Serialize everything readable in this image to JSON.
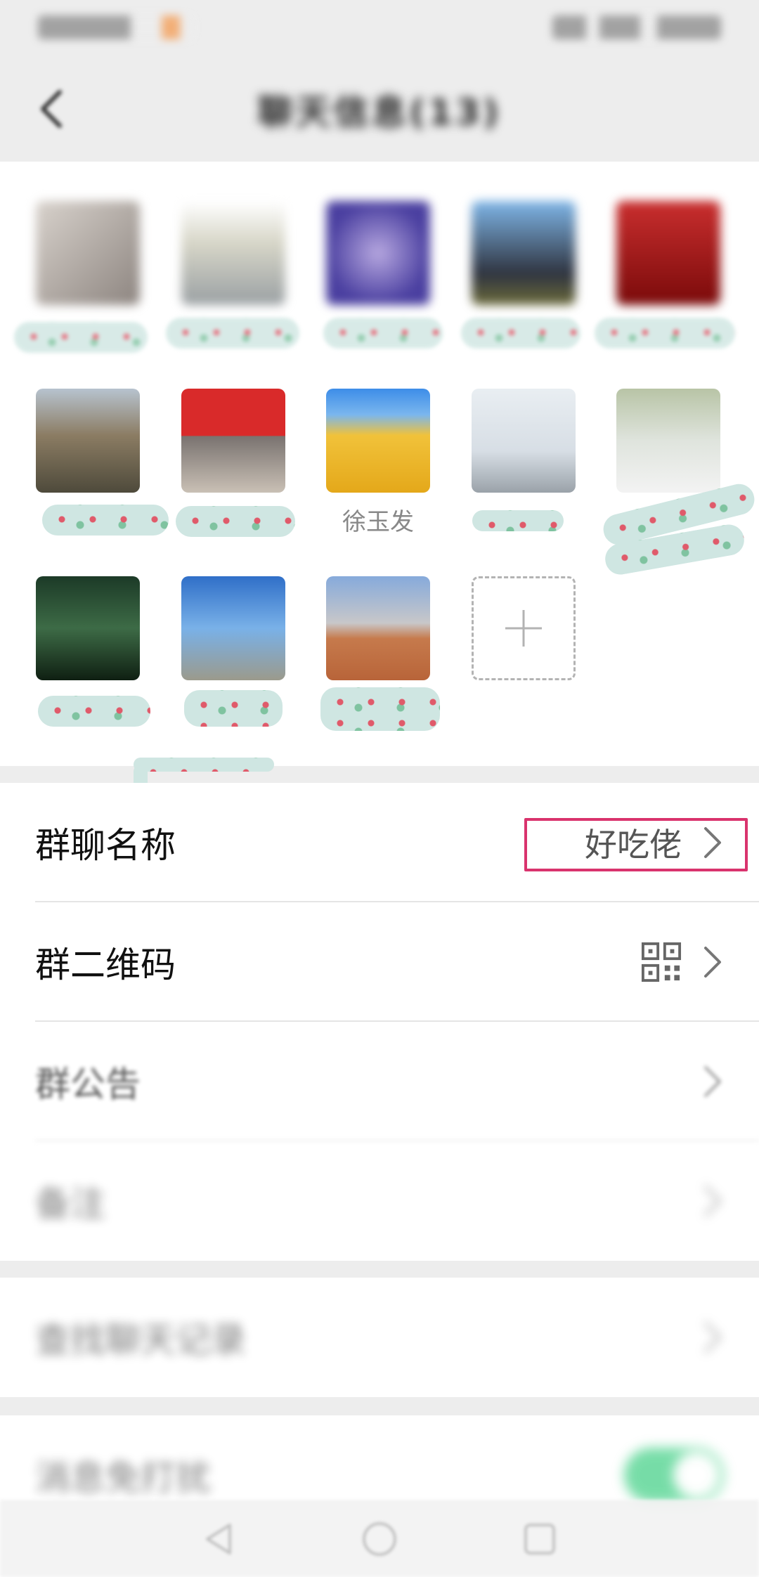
{
  "statusbar": {
    "left_text": "",
    "right_text": ""
  },
  "header": {
    "title": "聊天信息(13)"
  },
  "members": [
    {
      "name": "",
      "bg": "linear-gradient(135deg,#d8d2cc,#8d8580)",
      "blurred": true
    },
    {
      "name": "",
      "bg": "linear-gradient(180deg,#ffffff,#d7d6c8 40%,#9aa0a3)",
      "blurred": true
    },
    {
      "name": "",
      "bg": "radial-gradient(circle,#b7a8e0,#4a3fa0 70%)",
      "blurred": true
    },
    {
      "name": "",
      "bg": "linear-gradient(180deg,#7fb6e8,#2f3440 70%,#6c6b3a)",
      "blurred": true
    },
    {
      "name": "",
      "bg": "linear-gradient(180deg,#c92e2e,#7a0a0a)",
      "blurred": true
    },
    {
      "name": "",
      "bg": "linear-gradient(180deg,#b7c3cf 0%,#8b7c63 45%,#4e4a3b 100%)",
      "blurred": false
    },
    {
      "name": "",
      "bg": "linear-gradient(180deg,#d92a2a 0%,#d92a2a 45%,#7a7370 46%,#c9c0b5 100%)",
      "blurred": false
    },
    {
      "name": "徐玉发",
      "bg": "linear-gradient(180deg,#3d8de8 0%,#7ab6ee 25%,#f1c23a 45%,#e4a81a 100%)",
      "blurred": false
    },
    {
      "name": "",
      "bg": "linear-gradient(180deg,#e9eef2 0%,#d7dee5 60%,#9aa2a9 100%)",
      "blurred": false
    },
    {
      "name": "",
      "bg": "linear-gradient(180deg,#b8c4a6 0%,#dfe4dd 50%,#f3f3f3 100%)",
      "blurred": false
    },
    {
      "name": "",
      "bg": "linear-gradient(180deg,#1c3a27 0%,#3d6b46 50%,#0f1f12 100%)",
      "blurred": false
    },
    {
      "name": "",
      "bg": "linear-gradient(180deg,#2f6fc8 0%,#79b1e8 50%,#9b9a8c 100%)",
      "blurred": false
    },
    {
      "name": "",
      "bg": "linear-gradient(180deg,#86aadb 0%,#c8c7c9 45%,#c67a4c 60%,#b86439 100%)",
      "blurred": false
    }
  ],
  "settings": {
    "group_name": {
      "label": "群聊名称",
      "value": "好吃佬"
    },
    "group_qrcode": {
      "label": "群二维码"
    },
    "group_notice": {
      "label": "群公告"
    },
    "remark": {
      "label": "备注"
    },
    "search_history": {
      "label": "查找聊天记录"
    },
    "mute": {
      "label": "消息免打扰",
      "enabled": true
    }
  },
  "colors": {
    "accent_highlight": "#d9336d",
    "toggle_on": "#07c160"
  }
}
